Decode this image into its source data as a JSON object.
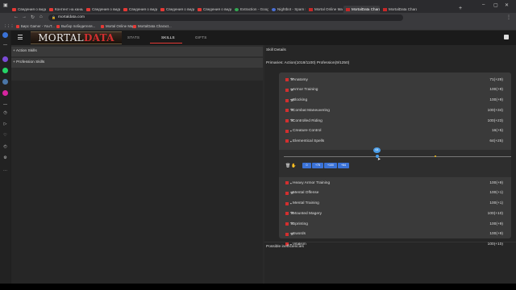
{
  "browser": {
    "tabs": [
      {
        "title": "Сведения о видео",
        "icon": "youtube-icon"
      },
      {
        "title": "Контент на канале",
        "icon": "youtube-icon"
      },
      {
        "title": "Сведения о видео",
        "icon": "youtube-icon"
      },
      {
        "title": "Сведения о видео",
        "icon": "youtube-icon"
      },
      {
        "title": "Сведения о видео",
        "icon": "youtube-icon"
      },
      {
        "title": "Сведения о видео",
        "icon": "youtube-icon"
      },
      {
        "title": "Extraction - Google",
        "icon": "google-icon"
      },
      {
        "title": "Nightbot - Spam Pr",
        "icon": "nightbot-icon"
      },
      {
        "title": "Mortal Online Map",
        "icon": "mortal-icon"
      },
      {
        "title": "MortalData Charact",
        "icon": "mortal-icon",
        "active": true
      },
      {
        "title": "MortalData Characte",
        "icon": "mortal-icon"
      }
    ],
    "url": "mortaldata.com",
    "bookmarks": [
      {
        "label": "Бирс Gamer - YouT..."
      },
      {
        "label": "Выбор победителя..."
      },
      {
        "label": "Mortal Online Map"
      },
      {
        "label": "MortalData Charact..."
      }
    ]
  },
  "app": {
    "logo_left": "MORTAL",
    "logo_right": "DATA",
    "nav": {
      "stats": "STATS",
      "skills": "SKILLS",
      "gifts": "GIFTS"
    },
    "left_panel": {
      "action_skills": "+ Action Skills",
      "profession_skills": "+ Profession Skills"
    },
    "right_panel": {
      "skill_details": "Skill Details",
      "summary": "Primaries: Action(1018/1100) Profession(9/1250)",
      "possible_inefficiencies": "Possible inefficiencies",
      "skills_top": [
        {
          "name": "Anatomy",
          "value": "71(+29)",
          "icon": "⚒"
        },
        {
          "name": "Armor Training",
          "value": "100(+9)",
          "icon": "⚒"
        },
        {
          "name": "Blocking",
          "value": "100(+9)",
          "icon": "⚒"
        },
        {
          "name": "Combat Maneuvering",
          "value": "100(+34)",
          "icon": "⚒"
        },
        {
          "name": "Controlled Riding",
          "value": "100(+23)",
          "icon": "⚒"
        },
        {
          "name": "Creature Control",
          "value": "16(+5)",
          "icon": "▪"
        },
        {
          "name": "Elementical Spells",
          "value": "64(+25)",
          "icon": "▪"
        }
      ],
      "slider": {
        "tooltip": "64",
        "buttons": [
          "0",
          "+75",
          "+100",
          "+64"
        ]
      },
      "skills_bottom": [
        {
          "name": "Heavy Armor Training",
          "value": "100(+9)",
          "icon": "▪"
        },
        {
          "name": "Mental Offense",
          "value": "100(+1)",
          "icon": "⚒"
        },
        {
          "name": "Mental Training",
          "value": "100(+1)",
          "icon": "▪"
        },
        {
          "name": "Mounted Magery",
          "value": "100(+10)",
          "icon": "⚒"
        },
        {
          "name": "Sprinting",
          "value": "100(+9)",
          "icon": "⚒"
        },
        {
          "name": "Swords",
          "value": "100(+9)",
          "icon": "⚒"
        },
        {
          "name": "Vitalism",
          "value": "100(+10)",
          "icon": "▪"
        }
      ]
    }
  },
  "colors": {
    "accent": "#d32f2f",
    "slider_blue": "#4a9de8",
    "button_blue": "#3a72d6"
  }
}
